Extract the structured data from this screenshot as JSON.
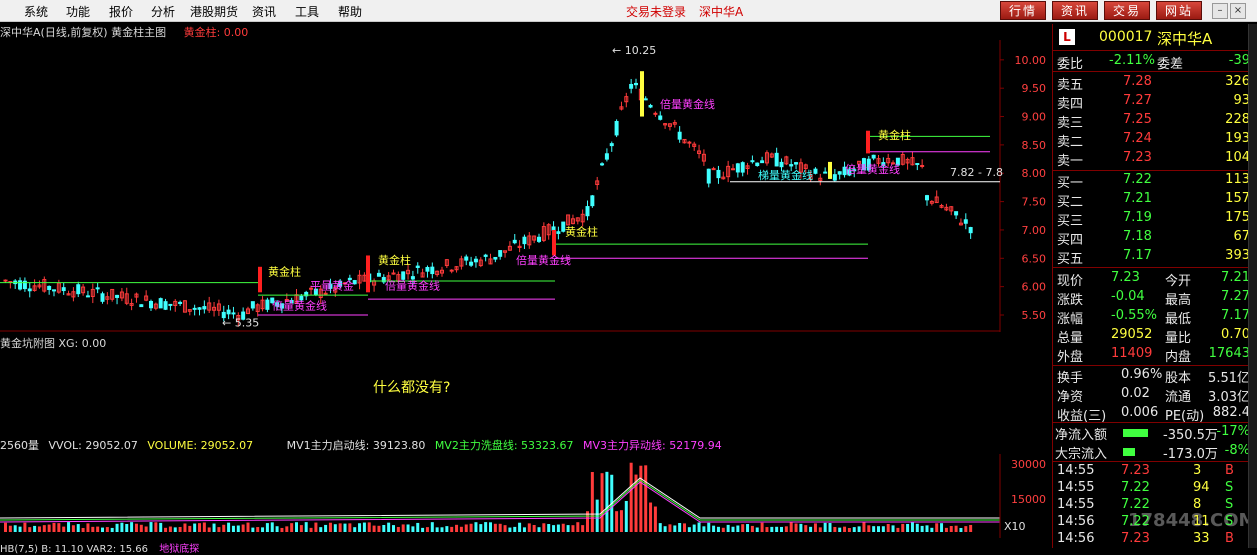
{
  "menubar": {
    "items": [
      "系统",
      "功能",
      "报价",
      "分析",
      "港股期货",
      "资讯",
      "工具",
      "帮助"
    ],
    "trade_status": "交易未登录",
    "stock_short": "深中华A",
    "nav_buttons": [
      "行情",
      "资讯",
      "交易",
      "网站"
    ]
  },
  "chart_header": {
    "title": "深中华A(日线,前复权) 黄金柱主图",
    "indicator": "黄金柱: 0.00"
  },
  "chart_data": {
    "type": "candlestick",
    "y_ticks": [
      "10.00",
      "9.50",
      "9.00",
      "8.50",
      "8.00",
      "7.50",
      "7.00",
      "6.50",
      "6.00",
      "5.50"
    ],
    "ylim": [
      5.2,
      10.35
    ],
    "high_label": "10.25",
    "low_label": "5.35",
    "last_range_label": "7.82 - 7.8",
    "annotations": [
      {
        "text": "黄金柱",
        "color": "yellow"
      },
      {
        "text": "倍量黄金线",
        "color": "magenta"
      },
      {
        "text": "黄金柱",
        "color": "yellow"
      },
      {
        "text": "倍量黄金线",
        "color": "magenta"
      },
      {
        "text": "黄金柱",
        "color": "yellow"
      },
      {
        "text": "倍量黄金线",
        "color": "magenta"
      },
      {
        "text": "倍量黄金线",
        "color": "magenta"
      },
      {
        "text": "梯量黄金线",
        "color": "cyan"
      },
      {
        "text": "黄金柱",
        "color": "yellow"
      },
      {
        "text": "倍量黄金线",
        "color": "magenta"
      },
      {
        "text": "平量黄金",
        "color": "magenta"
      }
    ],
    "volume_ticks": [
      "30000",
      "15000"
    ],
    "volume_scale": "X10"
  },
  "sub_chart": {
    "title": "黄金坑附图 XG: 0.00",
    "message": "什么都没有?"
  },
  "volume_legend": {
    "name": "2560量",
    "vvol": "VVOL: 29052.07",
    "volume": "VOLUME: 29052.07",
    "mv1": "MV1主力启动线: 39123.80",
    "mv2": "MV2主力洗盘线: 53323.67",
    "mv3": "MV3主力异动线: 52179.94"
  },
  "bottom_strip": "HB(7,5)  B: 11.10  VAR2: 15.66",
  "bottom_strip_extra": "地狱底探",
  "watermark": "178448.COM",
  "quote": {
    "code": "000017",
    "name": "深中华A",
    "weibi_label": "委比",
    "weibi": "-2.11%",
    "weicha_label": "委差",
    "weicha": "-39",
    "asks": [
      {
        "label": "卖五",
        "price": "7.28",
        "vol": "326"
      },
      {
        "label": "卖四",
        "price": "7.27",
        "vol": "93"
      },
      {
        "label": "卖三",
        "price": "7.25",
        "vol": "228"
      },
      {
        "label": "卖二",
        "price": "7.24",
        "vol": "193"
      },
      {
        "label": "卖一",
        "price": "7.23",
        "vol": "104"
      }
    ],
    "bids": [
      {
        "label": "买一",
        "price": "7.22",
        "vol": "113"
      },
      {
        "label": "买二",
        "price": "7.21",
        "vol": "157"
      },
      {
        "label": "买三",
        "price": "7.19",
        "vol": "175"
      },
      {
        "label": "买四",
        "price": "7.18",
        "vol": "67"
      },
      {
        "label": "买五",
        "price": "7.17",
        "vol": "393"
      }
    ],
    "stats": [
      {
        "l1": "现价",
        "v1": "7.23",
        "c1": "green",
        "l2": "今开",
        "v2": "7.21",
        "c2": "green"
      },
      {
        "l1": "涨跌",
        "v1": "-0.04",
        "c1": "green",
        "l2": "最高",
        "v2": "7.27",
        "c2": "green"
      },
      {
        "l1": "涨幅",
        "v1": "-0.55%",
        "c1": "green",
        "l2": "最低",
        "v2": "7.17",
        "c2": "green"
      },
      {
        "l1": "总量",
        "v1": "29052",
        "c1": "yellow",
        "l2": "量比",
        "v2": "0.70",
        "c2": "yellow"
      },
      {
        "l1": "外盘",
        "v1": "11409",
        "c1": "red",
        "l2": "内盘",
        "v2": "17643",
        "c2": "green"
      }
    ],
    "stats2": [
      {
        "l1": "换手",
        "v1": "0.96%",
        "l2": "股本",
        "v2": "5.51亿"
      },
      {
        "l1": "净资",
        "v1": "0.02",
        "l2": "流通",
        "v2": "3.03亿"
      },
      {
        "l1": "收益(三)",
        "v1": "0.006",
        "l2": "PE(动)",
        "v2": "882.4"
      }
    ],
    "flows": [
      {
        "label": "净流入额",
        "value": "-350.5万",
        "pct": "-17%",
        "bar": 0.42
      },
      {
        "label": "大宗流入",
        "value": "-173.0万",
        "pct": "-8%",
        "bar": 0.2
      }
    ],
    "ticks": [
      {
        "time": "14:55",
        "price": "7.23",
        "vol": "3",
        "side": "B"
      },
      {
        "time": "14:55",
        "price": "7.22",
        "vol": "94",
        "side": "S"
      },
      {
        "time": "14:55",
        "price": "7.22",
        "vol": "8",
        "side": "S"
      },
      {
        "time": "14:56",
        "price": "7.22",
        "vol": "11",
        "side": "S"
      },
      {
        "time": "14:56",
        "price": "7.23",
        "vol": "33",
        "side": "B"
      }
    ]
  }
}
